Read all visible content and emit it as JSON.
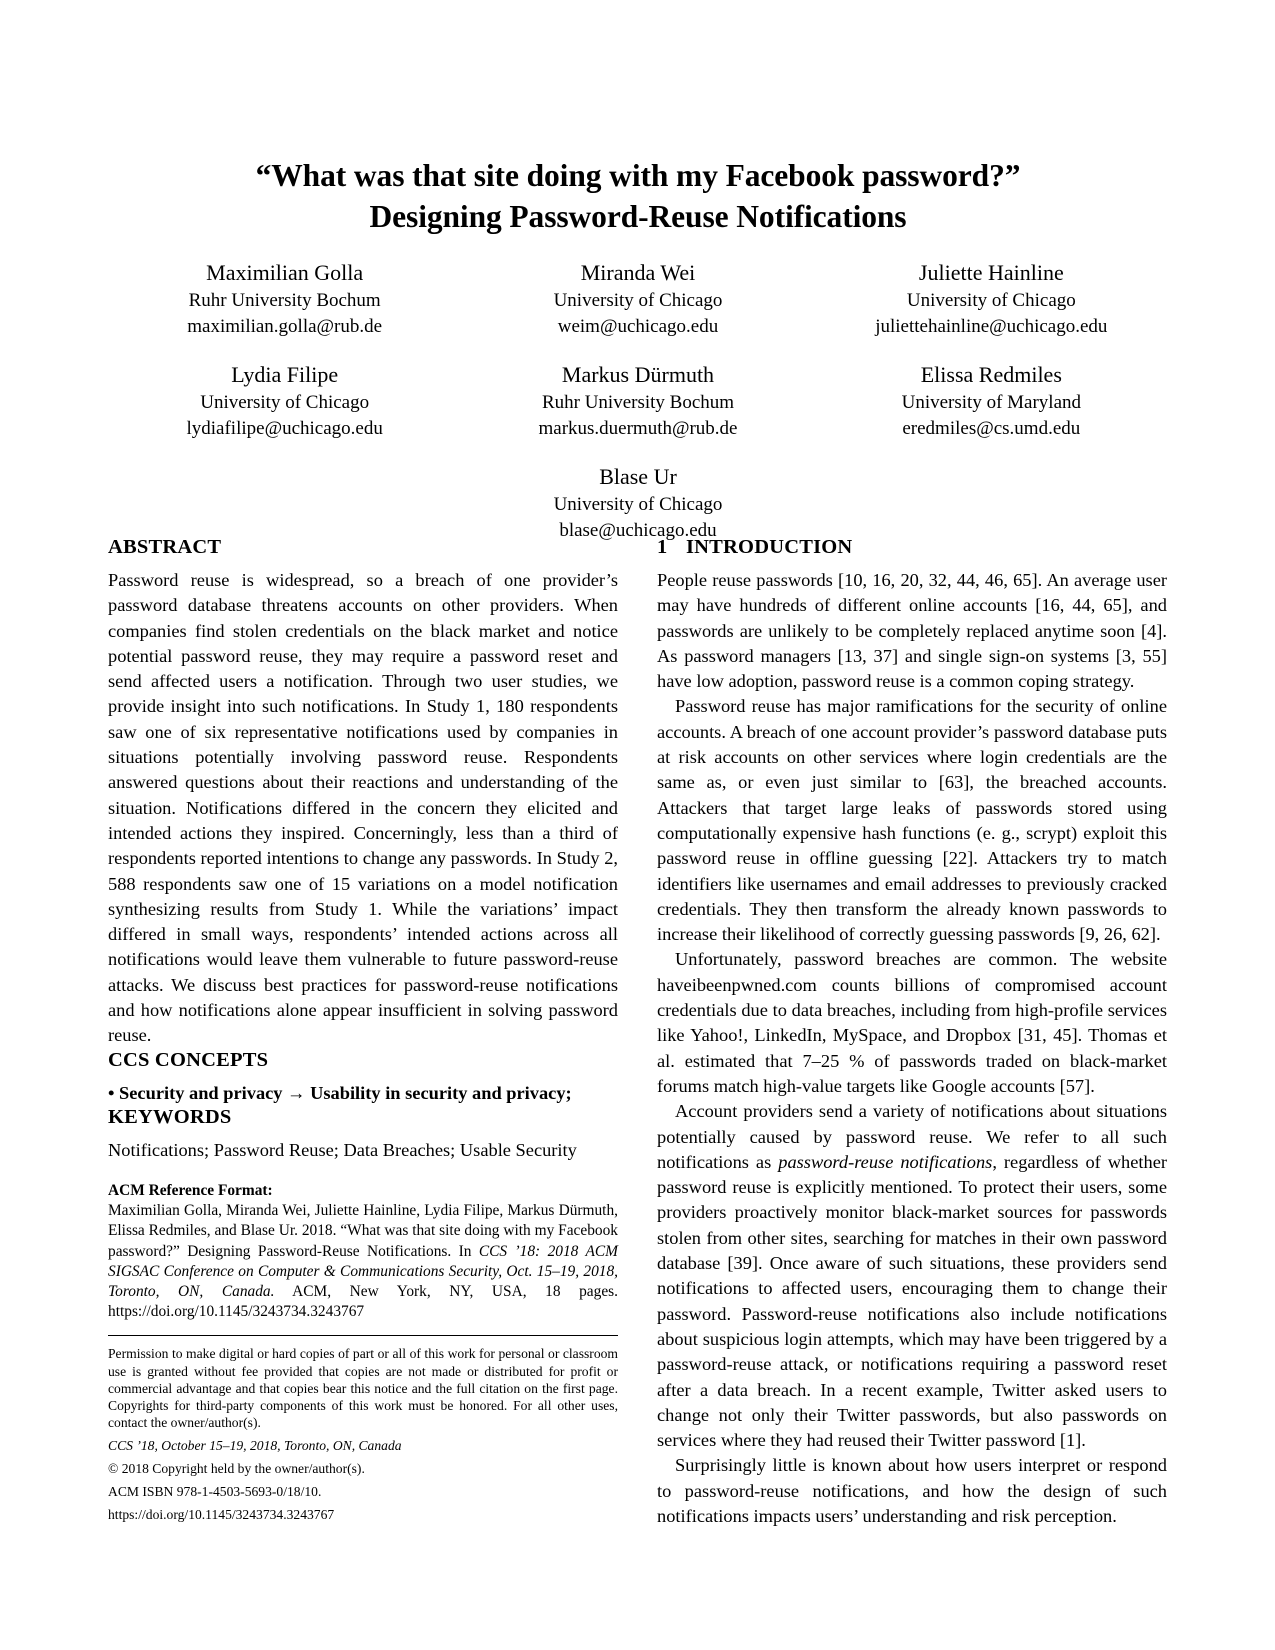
{
  "paper": {
    "title_lines": [
      "“What was that site doing with my Facebook password?”",
      "Designing Password-Reuse Notifications"
    ],
    "authors": [
      {
        "name": "Maximilian Golla",
        "affiliation": "Ruhr University Bochum",
        "email": "maximilian.golla@rub.de"
      },
      {
        "name": "Miranda Wei",
        "affiliation": "University of Chicago",
        "email": "weim@uchicago.edu"
      },
      {
        "name": "Juliette Hainline",
        "affiliation": "University of Chicago",
        "email": "juliettehainline@uchicago.edu"
      },
      {
        "name": "Lydia Filipe",
        "affiliation": "University of Chicago",
        "email": "lydiafilipe@uchicago.edu"
      },
      {
        "name": "Markus Dürmuth",
        "affiliation": "Ruhr University Bochum",
        "email": "markus.duermuth@rub.de"
      },
      {
        "name": "Elissa Redmiles",
        "affiliation": "University of Maryland",
        "email": "eredmiles@cs.umd.edu"
      },
      {
        "name": "Blase Ur",
        "affiliation": "University of Chicago",
        "email": "blase@uchicago.edu"
      }
    ],
    "abstract": {
      "heading": "ABSTRACT",
      "text": "Password reuse is widespread, so a breach of one provider’s password database threatens accounts on other providers. When companies find stolen credentials on the black market and notice potential password reuse, they may require a password reset and send affected users a notification. Through two user studies, we provide insight into such notifications. In Study 1, 180 respondents saw one of six representative notifications used by companies in situations potentially involving password reuse. Respondents answered questions about their reactions and understanding of the situation. Notifications differed in the concern they elicited and intended actions they inspired. Concerningly, less than a third of respondents reported intentions to change any passwords. In Study 2, 588 respondents saw one of 15 variations on a model notification synthesizing results from Study 1. While the variations’ impact differed in small ways, respondents’ intended actions across all notifications would leave them vulnerable to future password-reuse attacks. We discuss best practices for password-reuse notifications and how notifications alone appear insufficient in solving password reuse."
    },
    "ccs_concepts": {
      "heading": "CCS CONCEPTS",
      "text": "• Security and privacy → Usability in security and privacy;"
    },
    "keywords": {
      "heading": "KEYWORDS",
      "text": "Notifications; Password Reuse; Data Breaches; Usable Security"
    },
    "acm_reference": {
      "label": "ACM Reference Format:",
      "part1": "Maximilian Golla, Miranda Wei, Juliette Hainline, Lydia Filipe, Markus Dürmuth, Elissa Redmiles, and Blase Ur. 2018. “What was that site doing with my Facebook password?” Designing Password-Reuse Notifications. In ",
      "italic1": "CCS ’18: 2018 ACM SIGSAC Conference on Computer & Communications Security, Oct. 15–19, 2018, Toronto, ON, Canada.",
      "part2": " ACM, New York, NY, USA, 18 pages. https://doi.org/10.1145/3243734.3243767"
    },
    "permission": {
      "text": "Permission to make digital or hard copies of part or all of this work for personal or classroom use is granted without fee provided that copies are not made or distributed for profit or commercial advantage and that copies bear this notice and the full citation on the first page. Copyrights for third-party components of this work must be honored. For all other uses, contact the owner/author(s).",
      "conference": "CCS ’18, October 15–19, 2018, Toronto, ON, Canada",
      "copyright": "© 2018 Copyright held by the owner/author(s).",
      "isbn": "ACM ISBN 978-1-4503-5693-0/18/10.",
      "doi": "https://doi.org/10.1145/3243734.3243767"
    },
    "introduction": {
      "number": "1",
      "heading": "INTRODUCTION",
      "paragraphs": [
        "People reuse passwords [10, 16, 20, 32, 44, 46, 65]. An average user may have hundreds of different online accounts [16, 44, 65], and passwords are unlikely to be completely replaced anytime soon [4]. As password managers [13, 37] and single sign-on systems [3, 55] have low adoption, password reuse is a common coping strategy.",
        "Password reuse has major ramifications for the security of online accounts. A breach of one account provider’s password database puts at risk accounts on other services where login credentials are the same as, or even just similar to [63], the breached accounts. Attackers that target large leaks of passwords stored using computationally expensive hash functions (e. g., scrypt) exploit this password reuse in offline guessing [22]. Attackers try to match identifiers like usernames and email addresses to previously cracked credentials. They then transform the already known passwords to increase their likelihood of correctly guessing passwords [9, 26, 62].",
        "Unfortunately, password breaches are common. The website haveibeenpwned.com counts billions of compromised account credentials due to data breaches, including from high-profile services like Yahoo!, LinkedIn, MySpace, and Dropbox [31, 45]. Thomas et al. estimated that 7–25 % of passwords traded on black-market forums match high-value targets like Google accounts [57]."
      ],
      "paragraph4": {
        "part1": "Account providers send a variety of notifications about situations potentially caused by password reuse. We refer to all such notifications as ",
        "italic1": "password-reuse notifications",
        "part2": ", regardless of whether password reuse is explicitly mentioned. To protect their users, some providers proactively monitor black-market sources for passwords stolen from other sites, searching for matches in their own password database [39]. Once aware of such situations, these providers send notifications to affected users, encouraging them to change their password. Password-reuse notifications also include notifications about suspicious login attempts, which may have been triggered by a password-reuse attack, or notifications requiring a password reset after a data breach. In a recent example, Twitter asked users to change not only their Twitter passwords, but also passwords on services where they had reused their Twitter password [1]."
      },
      "paragraph5": "Surprisingly little is known about how users interpret or respond to password-reuse notifications, and how the design of such notifications impacts users’ understanding and risk perception."
    }
  }
}
